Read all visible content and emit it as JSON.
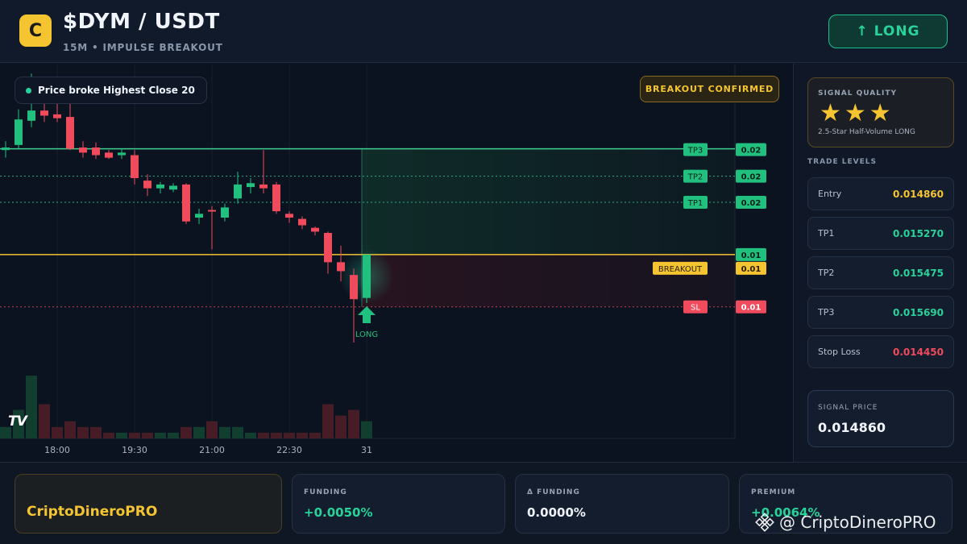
{
  "header": {
    "logo_letter": "C",
    "title": "$DYM / USDT",
    "subtitle": "15M • IMPULSE BREAKOUT",
    "long_button": "↑ LONG"
  },
  "chart": {
    "status_text": "Price broke Highest Close 20",
    "breakout_badge": "BREAKOUT CONFIRMED",
    "tv_logo": "TV",
    "signal_marker_label": "LONG",
    "colors": {
      "up": "#22c07f",
      "down": "#ef4b5c",
      "entry": "#f5c531",
      "tp": "#27d39a",
      "sl": "#ef4b5c"
    }
  },
  "chart_data": {
    "type": "candlestick",
    "x_ticks": [
      "18:00",
      "19:30",
      "21:00",
      "22:30",
      "31"
    ],
    "price_range": [
      0.01405,
      0.01601
    ],
    "candles": [
      {
        "o": 0.01568,
        "h": 0.01575,
        "l": 0.01562,
        "c": 0.0157,
        "v": 2
      },
      {
        "o": 0.01572,
        "h": 0.016,
        "l": 0.01569,
        "c": 0.01592,
        "v": 5
      },
      {
        "o": 0.01591,
        "h": 0.01628,
        "l": 0.01586,
        "c": 0.01599,
        "v": 11
      },
      {
        "o": 0.01599,
        "h": 0.01617,
        "l": 0.0159,
        "c": 0.01595,
        "v": 6
      },
      {
        "o": 0.01596,
        "h": 0.01621,
        "l": 0.0159,
        "c": 0.01593,
        "v": 2
      },
      {
        "o": 0.01594,
        "h": 0.01605,
        "l": 0.01568,
        "c": 0.01569,
        "v": 3
      },
      {
        "o": 0.0157,
        "h": 0.01575,
        "l": 0.01562,
        "c": 0.01566,
        "v": 2
      },
      {
        "o": 0.0157,
        "h": 0.01574,
        "l": 0.01561,
        "c": 0.01564,
        "v": 2
      },
      {
        "o": 0.01566,
        "h": 0.01568,
        "l": 0.01561,
        "c": 0.01562,
        "v": 1
      },
      {
        "o": 0.01564,
        "h": 0.01569,
        "l": 0.01561,
        "c": 0.01566,
        "v": 1
      },
      {
        "o": 0.01564,
        "h": 0.01568,
        "l": 0.01541,
        "c": 0.01546,
        "v": 1
      },
      {
        "o": 0.01544,
        "h": 0.01549,
        "l": 0.01532,
        "c": 0.01538,
        "v": 1
      },
      {
        "o": 0.01538,
        "h": 0.01543,
        "l": 0.01534,
        "c": 0.01541,
        "v": 1
      },
      {
        "o": 0.01537,
        "h": 0.01542,
        "l": 0.01535,
        "c": 0.0154,
        "v": 1
      },
      {
        "o": 0.01541,
        "h": 0.01542,
        "l": 0.0151,
        "c": 0.01512,
        "v": 2
      },
      {
        "o": 0.01515,
        "h": 0.01522,
        "l": 0.0151,
        "c": 0.01518,
        "v": 2
      },
      {
        "o": 0.01521,
        "h": 0.01524,
        "l": 0.0149,
        "c": 0.0152,
        "v": 3
      },
      {
        "o": 0.01515,
        "h": 0.01526,
        "l": 0.01512,
        "c": 0.01523,
        "v": 2
      },
      {
        "o": 0.0153,
        "h": 0.01551,
        "l": 0.01526,
        "c": 0.01541,
        "v": 2
      },
      {
        "o": 0.01539,
        "h": 0.01546,
        "l": 0.01534,
        "c": 0.01542,
        "v": 1
      },
      {
        "o": 0.01541,
        "h": 0.01568,
        "l": 0.01534,
        "c": 0.01538,
        "v": 1
      },
      {
        "o": 0.01541,
        "h": 0.01543,
        "l": 0.01518,
        "c": 0.0152,
        "v": 1
      },
      {
        "o": 0.01518,
        "h": 0.0152,
        "l": 0.01511,
        "c": 0.01515,
        "v": 1
      },
      {
        "o": 0.01514,
        "h": 0.01516,
        "l": 0.01506,
        "c": 0.01509,
        "v": 1
      },
      {
        "o": 0.01507,
        "h": 0.01508,
        "l": 0.01501,
        "c": 0.01504,
        "v": 1
      },
      {
        "o": 0.01503,
        "h": 0.01504,
        "l": 0.01471,
        "c": 0.0148,
        "v": 6
      },
      {
        "o": 0.0148,
        "h": 0.01493,
        "l": 0.01465,
        "c": 0.01473,
        "v": 4
      },
      {
        "o": 0.0147,
        "h": 0.01475,
        "l": 0.01417,
        "c": 0.01451,
        "v": 5
      },
      {
        "o": 0.01452,
        "h": 0.01486,
        "l": 0.01448,
        "c": 0.01486,
        "v": 3
      }
    ],
    "volume_max": 12,
    "levels": [
      {
        "name": "TP3",
        "price": 0.01569,
        "label": "0.02",
        "style": "solid"
      },
      {
        "name": "TP2",
        "price": 0.015475,
        "label": "0.02",
        "style": "dotted"
      },
      {
        "name": "TP1",
        "price": 0.01527,
        "label": "0.02",
        "style": "dotted"
      },
      {
        "name": "",
        "price": 0.01486,
        "label": "0.01",
        "style": "entry"
      },
      {
        "name": "BREAKOUT",
        "price": 0.01486,
        "label": "0.01",
        "style": "breakout"
      },
      {
        "name": "SL",
        "price": 0.01445,
        "label": "0.01",
        "style": "dotted-sl"
      }
    ]
  },
  "side": {
    "quality_label": "SIGNAL QUALITY",
    "stars": "★★★",
    "quality_desc": "2.5-Star Half-Volume LONG",
    "levels_title": "TRADE LEVELS",
    "levels": [
      {
        "name": "Entry",
        "value": "0.014860",
        "color": "#f5c531"
      },
      {
        "name": "TP1",
        "value": "0.015270",
        "color": "#27d39a"
      },
      {
        "name": "TP2",
        "value": "0.015475",
        "color": "#27d39a"
      },
      {
        "name": "TP3",
        "value": "0.015690",
        "color": "#27d39a"
      },
      {
        "name": "Stop Loss",
        "value": "0.014450",
        "color": "#ef4b5c"
      }
    ],
    "signal_price_label": "SIGNAL PRICE",
    "signal_price": "0.014860"
  },
  "footer": {
    "brand": "CriptoDineroPRO",
    "metrics": [
      {
        "label": "FUNDING",
        "value": "+0.0050%",
        "color": "#27d39a"
      },
      {
        "label": "Δ FUNDING",
        "value": "0.0000%",
        "color": "#eef3fa"
      },
      {
        "label": "PREMIUM",
        "value": "+0.0064%",
        "color": "#27d39a"
      }
    ],
    "watermark": "@ CriptoDineroPRO"
  }
}
